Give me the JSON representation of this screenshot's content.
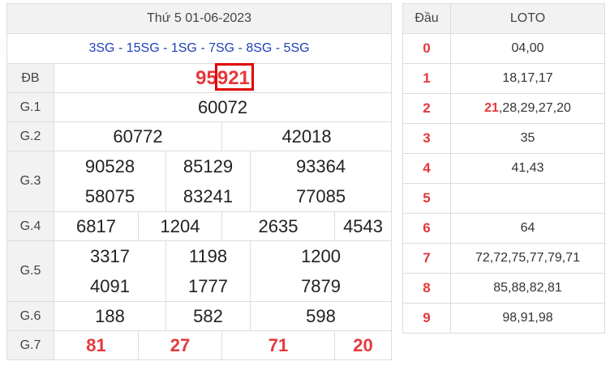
{
  "header": {
    "date_title": "Thứ 5 01-06-2023",
    "codes": "3SG - 15SG - 1SG - 7SG - 8SG - 5SG"
  },
  "prizes": {
    "db": {
      "label": "ĐB",
      "value": "95921"
    },
    "g1": {
      "label": "G.1",
      "values": [
        "60072"
      ]
    },
    "g2": {
      "label": "G.2",
      "values": [
        "60772",
        "42018"
      ]
    },
    "g3": {
      "label": "G.3",
      "values": [
        "90528",
        "85129",
        "93364",
        "58075",
        "83241",
        "77085"
      ]
    },
    "g4": {
      "label": "G.4",
      "values": [
        "6817",
        "1204",
        "2635",
        "4543"
      ]
    },
    "g5": {
      "label": "G.5",
      "values": [
        "3317",
        "1198",
        "1200",
        "4091",
        "1777",
        "7879"
      ]
    },
    "g6": {
      "label": "G.6",
      "values": [
        "188",
        "582",
        "598"
      ]
    },
    "g7": {
      "label": "G.7",
      "values": [
        "81",
        "27",
        "71",
        "20"
      ]
    }
  },
  "loto": {
    "head_dau": "Đầu",
    "head_loto": "LOTO",
    "rows": [
      {
        "dau": "0",
        "hi": "",
        "rest": "04,00"
      },
      {
        "dau": "1",
        "hi": "",
        "rest": "18,17,17"
      },
      {
        "dau": "2",
        "hi": "21",
        "rest": ",28,29,27,20"
      },
      {
        "dau": "3",
        "hi": "",
        "rest": "35"
      },
      {
        "dau": "4",
        "hi": "",
        "rest": "41,43"
      },
      {
        "dau": "5",
        "hi": "",
        "rest": ""
      },
      {
        "dau": "6",
        "hi": "",
        "rest": "64"
      },
      {
        "dau": "7",
        "hi": "",
        "rest": "72,72,75,77,79,71"
      },
      {
        "dau": "8",
        "hi": "",
        "rest": "85,88,82,81"
      },
      {
        "dau": "9",
        "hi": "",
        "rest": "98,91,98"
      }
    ]
  },
  "colors": {
    "accent_red": "#e5383b",
    "codes_blue": "#1f3fb8",
    "header_bg": "#f2f2f2"
  }
}
